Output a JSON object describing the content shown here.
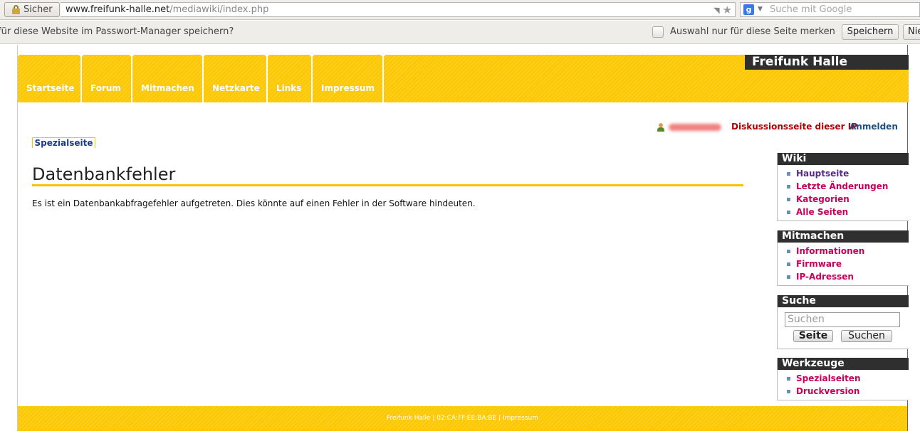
{
  "browser": {
    "secure_label": "Sicher",
    "url_host": "www.freifunk-halle.net",
    "url_path": "/mediawiki/index.php",
    "search_placeholder": "Suche mit Google",
    "search_engine_letter": "g"
  },
  "password_bar": {
    "message": "für diese Website im Passwort-Manager speichern?",
    "checkbox_label": "Auswahl nur für diese Seite merken",
    "save_label": "Speichern",
    "never_label": "Nie"
  },
  "site": {
    "brand": "Freifunk Halle",
    "nav": [
      "Startseite",
      "Forum",
      "Mitmachen",
      "Netzkarte",
      "Links",
      "Impressum"
    ],
    "accent_color": "#fcc804"
  },
  "userbar": {
    "discussion": "Diskussionsseite dieser IP",
    "login": "Anmelden"
  },
  "content": {
    "tab": "Spezialseite",
    "title": "Datenbankfehler",
    "message": "Es ist ein Datenbankabfragefehler aufgetreten. Dies könnte auf einen Fehler in der Software hindeuten."
  },
  "sidebar": {
    "wiki": {
      "heading": "Wiki",
      "items": [
        "Hauptseite",
        "Letzte Änderungen",
        "Kategorien",
        "Alle Seiten"
      ]
    },
    "mitmachen": {
      "heading": "Mitmachen",
      "items": [
        "Informationen",
        "Firmware",
        "IP-Adressen"
      ]
    },
    "suche": {
      "heading": "Suche",
      "placeholder": "Suchen",
      "go_label": "Seite",
      "search_label": "Suchen"
    },
    "werkzeuge": {
      "heading": "Werkzeuge",
      "items": [
        "Spezialseiten",
        "Druckversion"
      ]
    }
  },
  "footer": {
    "text": "Freifunk Halle | 02:CA:FF:EE:BA:BE | Impressum"
  }
}
